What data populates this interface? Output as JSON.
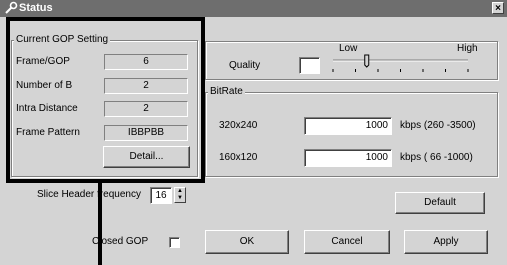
{
  "window": {
    "title": "Status",
    "close_glyph": "×"
  },
  "gop": {
    "legend": "Current GOP Setting",
    "rows": [
      {
        "label": "Frame/GOP",
        "value": "6"
      },
      {
        "label": "Number of B",
        "value": "2"
      },
      {
        "label": "Intra Distance",
        "value": "2"
      },
      {
        "label": "Frame Pattern",
        "value": "IBBPBB"
      }
    ],
    "detail_label": "Detail..."
  },
  "quality": {
    "label": "Quality",
    "low": "Low",
    "high": "High",
    "level": 0.25
  },
  "bitrate": {
    "legend": "BitRate",
    "rows": [
      {
        "res": "320x240",
        "value": "1000",
        "range": "kbps (260 -3500)"
      },
      {
        "res": "160x120",
        "value": "1000",
        "range": "kbps ( 66 -1000)"
      }
    ]
  },
  "slice": {
    "label": "Slice Header frequency",
    "value": "16"
  },
  "closed_gop": {
    "label": "Closed GOP",
    "checked": false
  },
  "buttons": {
    "default": "Default",
    "ok": "OK",
    "cancel": "Cancel",
    "apply": "Apply"
  },
  "colors": {
    "titlebar": "#6e6e6e",
    "face": "#d4d4d4",
    "highlight": "#000000"
  }
}
